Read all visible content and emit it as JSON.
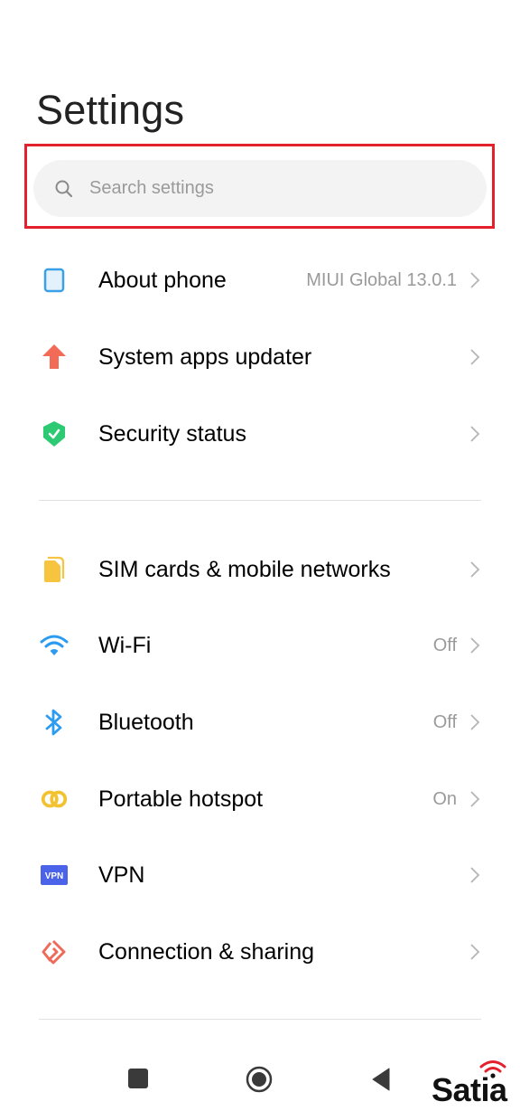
{
  "header": {
    "title": "Settings"
  },
  "search": {
    "placeholder": "Search settings",
    "value": "",
    "icon": "search-icon"
  },
  "highlight_color": "#e3212c",
  "groups": [
    {
      "items": [
        {
          "id": "about-phone",
          "label": "About phone",
          "value": "MIUI Global 13.0.1",
          "icon": "phone-icon",
          "icon_color": "#3ba0e6"
        },
        {
          "id": "system-apps-updater",
          "label": "System apps updater",
          "value": "",
          "icon": "arrow-up-icon",
          "icon_color": "#f26b57"
        },
        {
          "id": "security-status",
          "label": "Security status",
          "value": "",
          "icon": "shield-check-icon",
          "icon_color": "#2dca73"
        }
      ]
    },
    {
      "items": [
        {
          "id": "sim-cards",
          "label": "SIM cards & mobile networks",
          "value": "",
          "icon": "sim-card-icon",
          "icon_color": "#f7c440"
        },
        {
          "id": "wifi",
          "label": "Wi-Fi",
          "value": "Off",
          "icon": "wifi-icon",
          "icon_color": "#2d9cf0"
        },
        {
          "id": "bluetooth",
          "label": "Bluetooth",
          "value": "Off",
          "icon": "bluetooth-icon",
          "icon_color": "#2d9cf0"
        },
        {
          "id": "portable-hotspot",
          "label": "Portable hotspot",
          "value": "On",
          "icon": "hotspot-link-icon",
          "icon_color": "#f2c230"
        },
        {
          "id": "vpn",
          "label": "VPN",
          "value": "",
          "icon": "vpn-icon",
          "icon_color": "#4a63e8",
          "icon_text": "VPN"
        },
        {
          "id": "connection-sharing",
          "label": "Connection & sharing",
          "value": "",
          "icon": "connection-sharing-icon",
          "icon_color": "#ee6a5a"
        }
      ]
    }
  ],
  "navbar": {
    "recents": "recents-icon",
    "home": "home-icon",
    "back": "back-icon"
  },
  "watermark": {
    "text": "Satia",
    "accent": "#e3212c"
  }
}
